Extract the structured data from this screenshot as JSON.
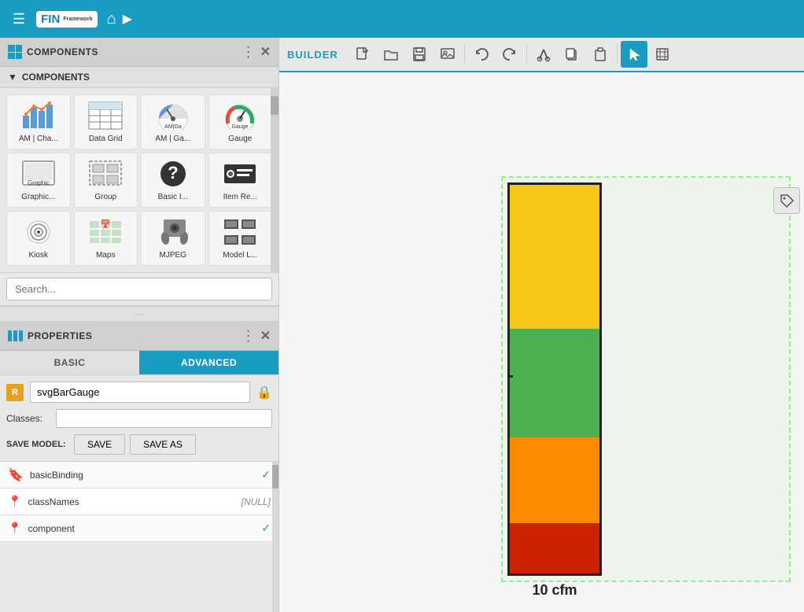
{
  "topbar": {
    "hamburger_label": "☰",
    "logo_text": "FIN",
    "logo_sub": "Framework",
    "home_icon": "⌂",
    "arrow_icon": "▶"
  },
  "components_panel": {
    "title": "COMPONENTS",
    "dots": "⋮",
    "close": "✕",
    "sub_title": "COMPONENTS",
    "sub_arrow": "▼",
    "items": [
      {
        "label": "AM | Cha...",
        "icon": "📊"
      },
      {
        "label": "Data Grid",
        "icon": "⊞"
      },
      {
        "label": "AM | Ga...",
        "icon": "🕐"
      },
      {
        "label": "Gauge",
        "icon": "⏱"
      },
      {
        "label": "Graphic...",
        "icon": "🖥"
      },
      {
        "label": "Group",
        "icon": "⬜"
      },
      {
        "label": "Basic I...",
        "icon": "❓"
      },
      {
        "label": "Item Re...",
        "icon": "🎬"
      },
      {
        "label": "Kiosk",
        "icon": "⊙"
      },
      {
        "label": "Maps",
        "icon": "🗺"
      },
      {
        "label": "MJPEG",
        "icon": "📷"
      },
      {
        "label": "Model L...",
        "icon": "▦"
      }
    ],
    "search_placeholder": "Search..."
  },
  "properties_panel": {
    "title": "PROPERTIES",
    "dots": "⋮",
    "close": "✕",
    "tab_basic": "BASIC",
    "tab_advanced": "ADVANCED",
    "component_name": "svgBarGauge",
    "classes_label": "Classes:",
    "classes_value": "",
    "save_model_label": "SAVE MODEL:",
    "save_label": "SAVE",
    "save_as_label": "SAVE AS",
    "properties": [
      {
        "pin": "bookmark",
        "name": "basicBinding",
        "value": "",
        "check": true,
        "pin_color": "orange"
      },
      {
        "pin": "pin",
        "name": "classNames",
        "value": "[NULL]",
        "check": false,
        "pin_color": "gray"
      },
      {
        "pin": "pin",
        "name": "component",
        "value": "",
        "check": true,
        "pin_color": "gray"
      }
    ]
  },
  "builder": {
    "title": "BUILDER",
    "toolbar": [
      {
        "icon": "📄",
        "name": "new",
        "active": false
      },
      {
        "icon": "📁",
        "name": "open",
        "active": false
      },
      {
        "icon": "💾",
        "name": "save",
        "active": false
      },
      {
        "icon": "🖼",
        "name": "image",
        "active": false
      },
      {
        "icon": "↺",
        "name": "undo",
        "active": false
      },
      {
        "icon": "↻",
        "name": "redo",
        "active": false
      },
      {
        "icon": "✂",
        "name": "cut",
        "active": false
      },
      {
        "icon": "⎘",
        "name": "copy",
        "active": false
      },
      {
        "icon": "📋",
        "name": "paste",
        "active": false
      },
      {
        "icon": "↖",
        "name": "select",
        "active": true
      },
      {
        "icon": "⬚",
        "name": "crop",
        "active": false
      }
    ]
  },
  "gauge_widget": {
    "label": "10 cfm",
    "tag_icon": "🏷",
    "segments": {
      "yellow": {
        "color": "#f5c518",
        "height_pct": 37
      },
      "green": {
        "color": "#4caf50",
        "height_pct": 28
      },
      "orange": {
        "color": "#ff8c00",
        "height_pct": 22
      },
      "red": {
        "color": "#cc2200",
        "height_pct": 13
      }
    }
  },
  "drag_handle": "···"
}
